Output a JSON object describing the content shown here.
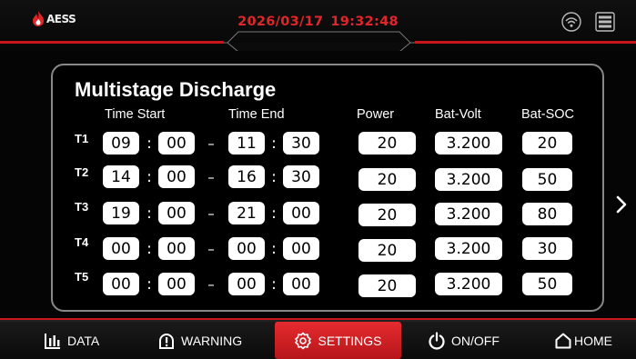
{
  "header": {
    "brand": "AESS",
    "date": "2026/03/17",
    "time": "19:32:48",
    "accent_color": "#e0262a",
    "icons": [
      "flame-logo-icon",
      "wifi-icon",
      "menu-icon"
    ]
  },
  "panel": {
    "title": "Multistage Discharge",
    "headers": {
      "time_start": "Time Start",
      "time_end": "Time End",
      "power": "Power",
      "bat_volt": "Bat-Volt",
      "bat_soc": "Bat-SOC"
    },
    "separators": {
      "colon": ":",
      "dash": "–"
    },
    "rows": [
      {
        "label": "T1",
        "start_h": "09",
        "start_m": "00",
        "end_h": "11",
        "end_m": "30",
        "power": "20",
        "volt": "3.200",
        "soc": "20"
      },
      {
        "label": "T2",
        "start_h": "14",
        "start_m": "00",
        "end_h": "16",
        "end_m": "30",
        "power": "20",
        "volt": "3.200",
        "soc": "50"
      },
      {
        "label": "T3",
        "start_h": "19",
        "start_m": "00",
        "end_h": "21",
        "end_m": "00",
        "power": "20",
        "volt": "3.200",
        "soc": "80"
      },
      {
        "label": "T4",
        "start_h": "00",
        "start_m": "00",
        "end_h": "00",
        "end_m": "00",
        "power": "20",
        "volt": "3.200",
        "soc": "30"
      },
      {
        "label": "T5",
        "start_h": "00",
        "start_m": "00",
        "end_h": "00",
        "end_m": "00",
        "power": "20",
        "volt": "3.200",
        "soc": "50"
      }
    ],
    "next_icon": "chevron-right-icon"
  },
  "nav": {
    "items": [
      {
        "label": "DATA",
        "icon": "bar-chart-icon"
      },
      {
        "label": "WARNING",
        "icon": "warning-icon"
      },
      {
        "label": "SETTINGS",
        "icon": "gear-icon",
        "active": true
      },
      {
        "label": "ON/OFF",
        "icon": "power-icon"
      },
      {
        "label": "HOME",
        "icon": "home-icon"
      }
    ]
  }
}
